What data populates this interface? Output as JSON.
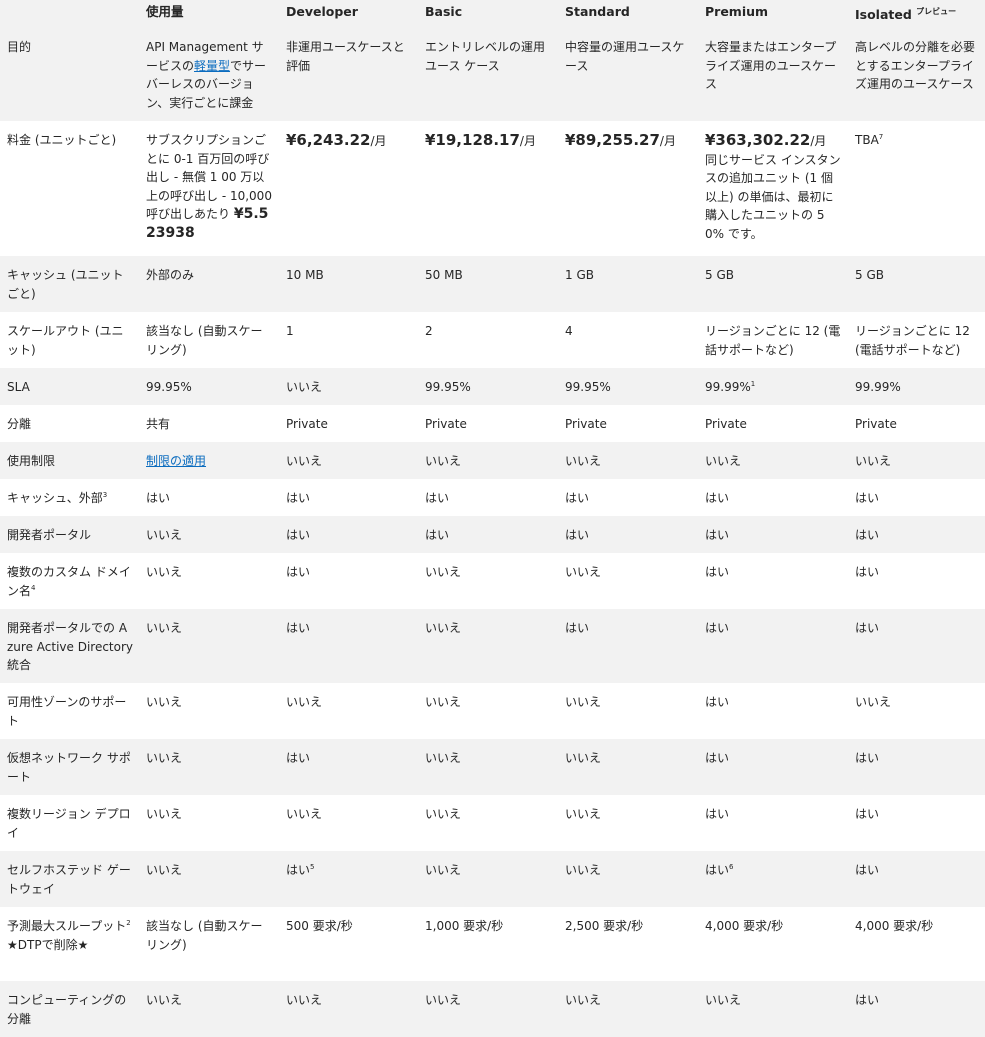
{
  "header": {
    "blank": "",
    "consumption": "使用量",
    "developer": "Developer",
    "basic": "Basic",
    "standard": "Standard",
    "premium": "Premium",
    "isolated": "Isolated",
    "isolated_preview": "プレビュー"
  },
  "rows": {
    "purpose": {
      "label": "目的",
      "consumption_pre": "API Management サービスの",
      "consumption_link": "軽量型",
      "consumption_post": "でサーバーレスのバージョン、実行ごとに課金",
      "developer": "非運用ユースケースと評価",
      "basic": "エントリレベルの運用ユース ケース",
      "standard": "中容量の運用ユースケース",
      "premium": "大容量またはエンタープライズ運用のユースケース",
      "isolated": "高レベルの分離を必要とするエンタープライズ運用のユースケース"
    },
    "price": {
      "label": "料金 (ユニットごと)",
      "consumption_text": "サブスクリプションごとに 0-1 百万回の呼び出し - 無償 1 00 万以上の呼び出し - 10,000 呼び出しあたり",
      "consumption_price": "¥5.523938",
      "developer_price": "¥6,243.22",
      "basic_price": "¥19,128.17",
      "standard_price": "¥89,255.27",
      "premium_price": "¥363,302.22",
      "per_month": "/月",
      "premium_note": "同じサービス インスタンスの追加ユニット (1 個以上) の単価は、最初に購入したユニットの 50% です。",
      "isolated": "TBA",
      "isolated_sup": "7"
    },
    "cache": {
      "label": "キャッシュ (ユニットごと)",
      "consumption": "外部のみ",
      "developer": "10 MB",
      "basic": "50 MB",
      "standard": "1 GB",
      "premium": "5 GB",
      "isolated": "5 GB"
    },
    "scaleout": {
      "label": "スケールアウト (ユニット)",
      "consumption": "該当なし (自動スケーリング)",
      "developer": "1",
      "basic": "2",
      "standard": "4",
      "premium": "リージョンごとに 12 (電話サポートなど)",
      "isolated": "リージョンごとに 12 (電話サポートなど)"
    },
    "sla": {
      "label": "SLA",
      "consumption": "99.95%",
      "developer": "いいえ",
      "basic": "99.95%",
      "standard": "99.95%",
      "premium": "99.99%",
      "premium_sup": "1",
      "isolated": "99.99%"
    },
    "isolation": {
      "label": "分離",
      "consumption": "共有",
      "developer": "Private",
      "basic": "Private",
      "standard": "Private",
      "premium": "Private",
      "isolated": "Private"
    },
    "limits": {
      "label": "使用制限",
      "consumption_link": "制限の適用",
      "developer": "いいえ",
      "basic": "いいえ",
      "standard": "いいえ",
      "premium": "いいえ",
      "isolated": "いいえ"
    },
    "ext_cache": {
      "label": "キャッシュ、外部",
      "label_sup": "3",
      "consumption": "はい",
      "developer": "はい",
      "basic": "はい",
      "standard": "はい",
      "premium": "はい",
      "isolated": "はい"
    },
    "dev_portal": {
      "label": "開発者ポータル",
      "consumption": "いいえ",
      "developer": "はい",
      "basic": "はい",
      "standard": "はい",
      "premium": "はい",
      "isolated": "はい"
    },
    "custom_domains": {
      "label": "複数のカスタム ドメイン名",
      "label_sup": "4",
      "consumption": "いいえ",
      "developer": "はい",
      "basic": "いいえ",
      "standard": "いいえ",
      "premium": "はい",
      "isolated": "はい"
    },
    "aad": {
      "label": "開発者ポータルでの Azure Active Directory 統合",
      "consumption": "いいえ",
      "developer": "はい",
      "basic": "いいえ",
      "standard": "はい",
      "premium": "はい",
      "isolated": "はい"
    },
    "az_support": {
      "label": "可用性ゾーンのサポート",
      "consumption": "いいえ",
      "developer": "いいえ",
      "basic": "いいえ",
      "standard": "いいえ",
      "premium": "はい",
      "isolated": "いいえ"
    },
    "vnet": {
      "label": "仮想ネットワーク サポート",
      "consumption": "いいえ",
      "developer": "はい",
      "basic": "いいえ",
      "standard": "いいえ",
      "premium": "はい",
      "isolated": "はい"
    },
    "multi_region": {
      "label": "複数リージョン デプロイ",
      "consumption": "いいえ",
      "developer": "いいえ",
      "basic": "いいえ",
      "standard": "いいえ",
      "premium": "はい",
      "isolated": "はい"
    },
    "shgw": {
      "label": "セルフホステッド ゲートウェイ",
      "consumption": "いいえ",
      "developer": "はい",
      "developer_sup": "5",
      "basic": "いいえ",
      "standard": "いいえ",
      "premium": "はい",
      "premium_sup": "6",
      "isolated": "はい"
    },
    "throughput": {
      "label": "予測最大スループット",
      "label_sup": "2",
      "label_note": "★DTPで削除★",
      "consumption": "該当なし (自動スケーリング)",
      "developer": "500 要求/秒",
      "basic": "1,000 要求/秒",
      "standard": "2,500 要求/秒",
      "premium": "4,000 要求/秒",
      "isolated": "4,000 要求/秒"
    },
    "compute_iso": {
      "label": "コンピューティングの分離",
      "consumption": "いいえ",
      "developer": "いいえ",
      "basic": "いいえ",
      "standard": "いいえ",
      "premium": "いいえ",
      "isolated": "はい"
    }
  }
}
